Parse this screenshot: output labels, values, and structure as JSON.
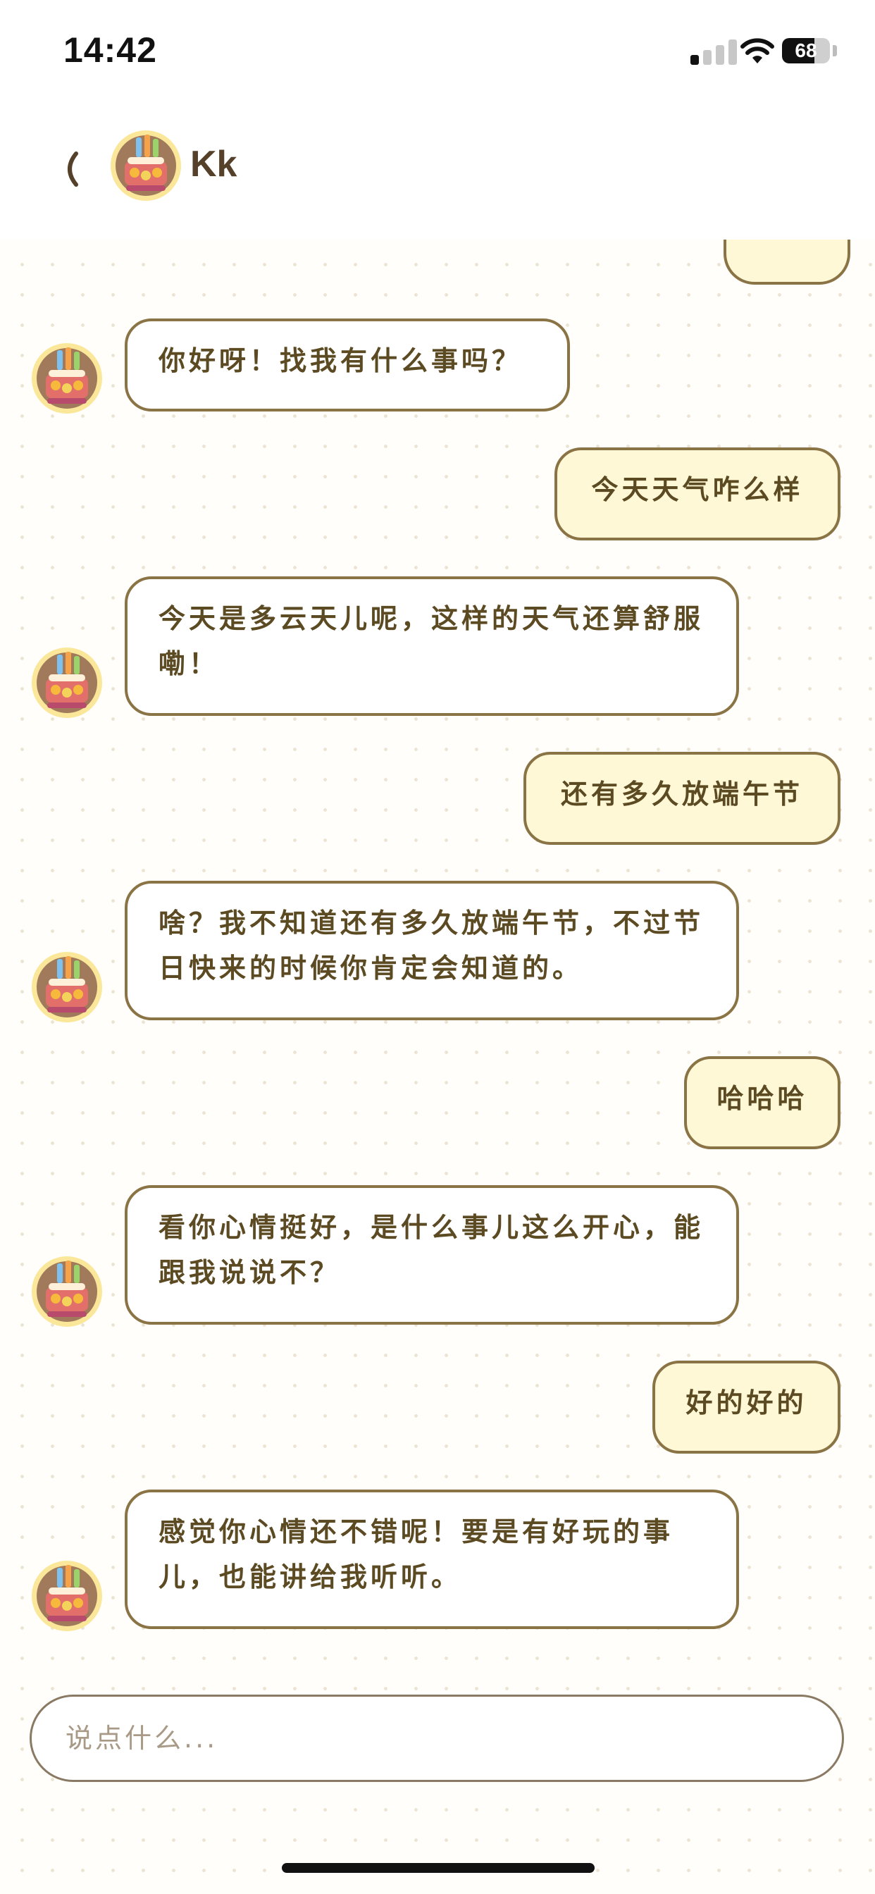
{
  "status_bar": {
    "time": "14:42",
    "battery_text": "68",
    "battery_level": 0.68,
    "signal_bars_active": 1
  },
  "header": {
    "back_icon": "back-arrow-icon",
    "contact_name": "Kk"
  },
  "messages": [
    {
      "sender": "bot",
      "text": "你好呀！找我有什么事吗？"
    },
    {
      "sender": "user",
      "text": "今天天气咋么样"
    },
    {
      "sender": "bot",
      "text": "今天是多云天儿呢，这样的天气还算舒服嘞！"
    },
    {
      "sender": "user",
      "text": "还有多久放端午节"
    },
    {
      "sender": "bot",
      "text": "啥？我不知道还有多久放端午节，不过节日快来的时候你肯定会知道的。"
    },
    {
      "sender": "user",
      "text": "哈哈哈"
    },
    {
      "sender": "bot",
      "text": "看你心情挺好，是什么事儿这么开心，能跟我说说不？"
    },
    {
      "sender": "user",
      "text": "好的好的"
    },
    {
      "sender": "bot",
      "text": "感觉你心情还不错呢！要是有好玩的事儿，也能讲给我听听。"
    }
  ],
  "input": {
    "placeholder": "说点什么..."
  },
  "colors": {
    "bubble_border": "#8a7344",
    "user_bubble_bg": "#fff8d6",
    "bot_bubble_bg": "#ffffff",
    "text": "#5b4a22"
  }
}
